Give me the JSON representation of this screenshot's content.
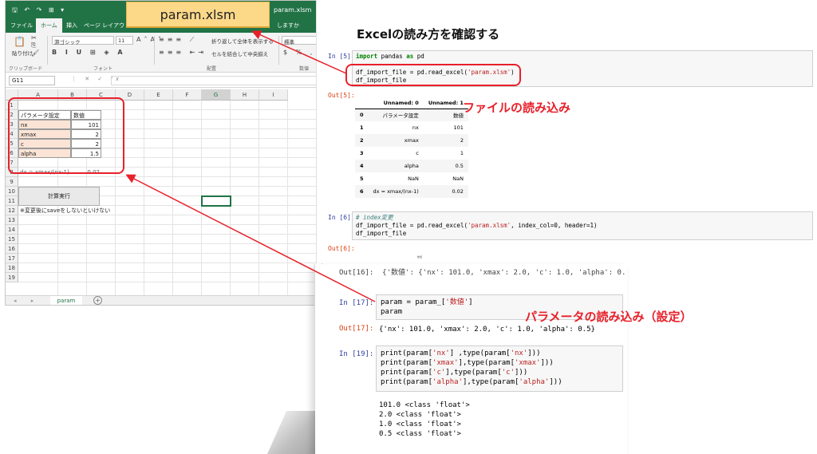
{
  "excel": {
    "window_title": "param.xlsm",
    "qa_icons": "🖫 ↶ ↷ ⊞ ▾",
    "ribbon_tabs": [
      "ファイル",
      "ホーム",
      "挿入",
      "ページ レイアウト"
    ],
    "active_tab": "ホーム",
    "search_hint": "しますか",
    "ribbon": {
      "paste": "貼り付け",
      "font_name": "游ゴシック",
      "font_size": "11",
      "wrap_text": "折り返して全体を表示する",
      "merge_center": "セルを結合して中央揃え",
      "number_format": "標準",
      "groups": [
        "クリップボード",
        "フォント",
        "配置",
        "数値"
      ]
    },
    "name_box": "G11",
    "fx": "fx",
    "columns": [
      "A",
      "B",
      "C",
      "D",
      "E",
      "F",
      "G",
      "H",
      "I"
    ],
    "rows": [
      "1",
      "2",
      "3",
      "4",
      "5",
      "6",
      "7",
      "8",
      "9",
      "10",
      "11",
      "12",
      "13",
      "14",
      "15",
      "16",
      "17",
      "18",
      "19"
    ],
    "table_header": [
      "パラメータ設定",
      "数値"
    ],
    "params": [
      {
        "name": "nx",
        "value": "101"
      },
      {
        "name": "xmax",
        "value": "2"
      },
      {
        "name": "c",
        "value": "2"
      },
      {
        "name": "alpha",
        "value": "1.5"
      }
    ],
    "row8_label": "dx = xmax/(nx-1)",
    "row8_value": "0.02",
    "calc_button": "計算実行",
    "note": "※変更後にsaveをしないといけない",
    "sheet_tab": "param",
    "nav_arrows": "◂ ▸",
    "add_sheet": "+"
  },
  "callout": "param.xlsm",
  "annotations": {
    "file_read": "ファイルの読み込み",
    "param_read": "パラメータの読み込み（設定）"
  },
  "notebook_top": {
    "title": "Excelの読み方を確認する",
    "cell5": {
      "in_prompt": "In [5]:",
      "line1_kw": "import",
      "line1_mod": " pandas ",
      "line1_kw2": "as",
      "line1_alias": " pd",
      "line2_a": "df_import_file = pd.read_excel(",
      "line2_str": "'param.xlsm'",
      "line2_b": ")",
      "line3": "df_import_file"
    },
    "out5": {
      "prompt": "Out[5]:",
      "columns": [
        "",
        "Unnamed: 0",
        "Unnamed: 1"
      ],
      "rows": [
        [
          "0",
          "パラメータ設定",
          "数値"
        ],
        [
          "1",
          "nx",
          "101"
        ],
        [
          "2",
          "xmax",
          "2"
        ],
        [
          "3",
          "c",
          "1"
        ],
        [
          "4",
          "alpha",
          "0.5"
        ],
        [
          "5",
          "NaN",
          "NaN"
        ],
        [
          "6",
          "dx = xmax/(nx-1)",
          "0.02"
        ]
      ]
    },
    "cell6": {
      "in_prompt": "In [6]:",
      "comment": "# index変更",
      "line2_a": "df_import_file = pd.read_excel(",
      "line2_str": "'param.xlsm'",
      "line2_b": ", index_col=0, header=1)",
      "line3": "df_import_file"
    },
    "out6": {
      "prompt": "Out[6]:",
      "tiny": "数値"
    }
  },
  "notebook_bottom": {
    "cut_line": "Out[16]:  {'数値': {'nx': 101.0, 'xmax': 2.0, 'c': 1.0, 'alpha': 0.",
    "cell17": {
      "in_prompt": "In [17]:",
      "line1_a": "param = param_[",
      "line1_str": "'数値'",
      "line1_b": "]",
      "line2": "param"
    },
    "out17": {
      "prompt": "Out[17]:",
      "text": "{'nx': 101.0, 'xmax': 2.0, 'c': 1.0, 'alpha': 0.5}"
    },
    "cell19": {
      "in_prompt": "In [19]:",
      "keys": [
        "'nx'",
        "'xmax'",
        "'c'",
        "'alpha'"
      ]
    },
    "output19": [
      "101.0 <class 'float'>",
      "2.0 <class 'float'>",
      "1.0 <class 'float'>",
      "0.5 <class 'float'>"
    ]
  },
  "colors": {
    "excel_green": "#217346",
    "annotation_red": "#e8202a",
    "callout_fill": "#fcd889",
    "param_name_fill": "#fbe4d5"
  }
}
